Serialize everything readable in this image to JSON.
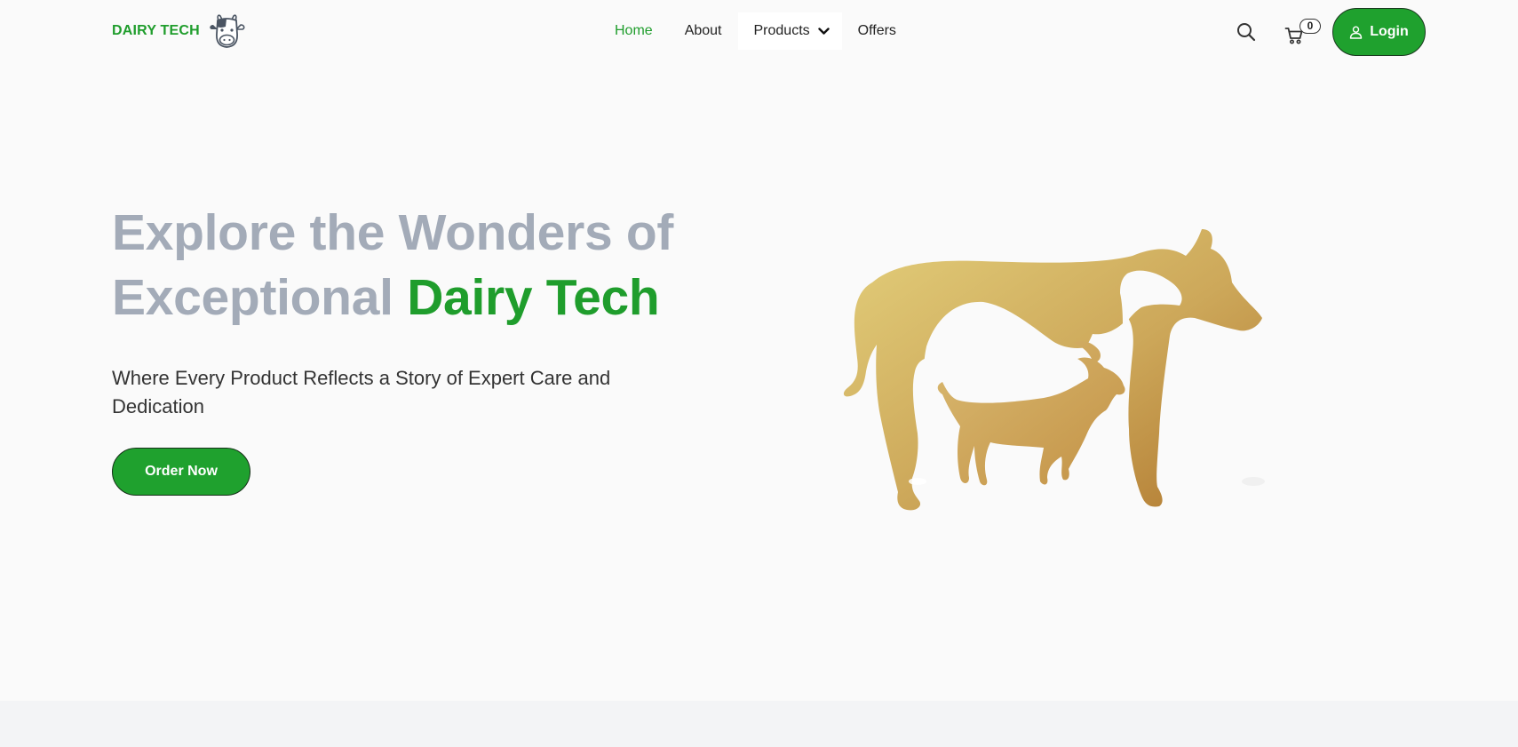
{
  "brand": {
    "name": "DAIRY TECH",
    "logo_icon": "cow-head-icon"
  },
  "nav": {
    "items": [
      {
        "label": "Home",
        "active": true
      },
      {
        "label": "About",
        "active": false
      },
      {
        "label": "Products",
        "active": false,
        "has_dropdown": true
      },
      {
        "label": "Offers",
        "active": false
      }
    ]
  },
  "actions": {
    "search_icon": "search-icon",
    "cart_icon": "cart-icon",
    "cart_count": "0",
    "login_label": "Login",
    "login_icon": "user-icon"
  },
  "hero": {
    "title_line1": "Explore the Wonders of",
    "title_line2_prefix": "Exceptional",
    "title_line2_accent": "Dairy Tech",
    "subtitle": "Where Every Product Reflects a Story of Expert Care and Dedication",
    "cta_label": "Order Now",
    "illustration": "cow-and-goat-silhouette"
  },
  "colors": {
    "brand_green": "#1f9d2c",
    "title_gray": "#a3abb8",
    "background": "#fafafa",
    "gold_light": "#e2cd78",
    "gold_dark": "#b47e34"
  }
}
